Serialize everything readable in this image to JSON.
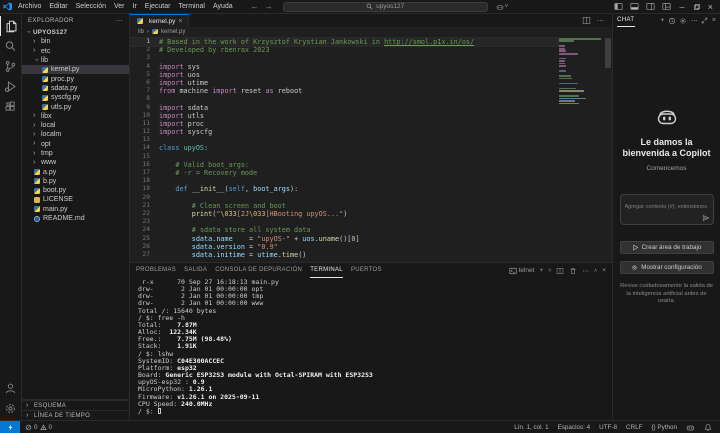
{
  "window": {
    "menus": [
      "Archivo",
      "Editar",
      "Selección",
      "Ver",
      "Ir",
      "Ejecutar",
      "Terminal",
      "Ayuda"
    ],
    "search_value": "upyos127"
  },
  "sidebar": {
    "header": "EXPLORADOR",
    "tree": [
      {
        "label": "UPYOS127",
        "depth": 0,
        "kind": "root",
        "state": "expanded"
      },
      {
        "label": "bin",
        "depth": 1,
        "kind": "folder",
        "state": "collapsed"
      },
      {
        "label": "etc",
        "depth": 1,
        "kind": "folder",
        "state": "collapsed"
      },
      {
        "label": "lib",
        "depth": 1,
        "kind": "folder",
        "state": "expanded"
      },
      {
        "label": "kernel.py",
        "depth": 2,
        "kind": "py",
        "selected": true
      },
      {
        "label": "proc.py",
        "depth": 2,
        "kind": "py"
      },
      {
        "label": "sdata.py",
        "depth": 2,
        "kind": "py"
      },
      {
        "label": "syscfg.py",
        "depth": 2,
        "kind": "py"
      },
      {
        "label": "utls.py",
        "depth": 2,
        "kind": "py"
      },
      {
        "label": "libx",
        "depth": 1,
        "kind": "folder",
        "state": "collapsed"
      },
      {
        "label": "local",
        "depth": 1,
        "kind": "folder",
        "state": "collapsed"
      },
      {
        "label": "localm",
        "depth": 1,
        "kind": "folder",
        "state": "collapsed"
      },
      {
        "label": "opt",
        "depth": 1,
        "kind": "folder",
        "state": "collapsed"
      },
      {
        "label": "tmp",
        "depth": 1,
        "kind": "folder",
        "state": "collapsed"
      },
      {
        "label": "www",
        "depth": 1,
        "kind": "folder",
        "state": "collapsed"
      },
      {
        "label": "a.py",
        "depth": 1,
        "kind": "py"
      },
      {
        "label": "b.py",
        "depth": 1,
        "kind": "py"
      },
      {
        "label": "boot.py",
        "depth": 1,
        "kind": "py"
      },
      {
        "label": "LICENSE",
        "depth": 1,
        "kind": "license"
      },
      {
        "label": "main.py",
        "depth": 1,
        "kind": "py"
      },
      {
        "label": "README.md",
        "depth": 1,
        "kind": "info"
      }
    ],
    "bottom_sections": [
      "ESQUEMA",
      "LÍNEA DE TIEMPO"
    ]
  },
  "editor": {
    "tab": {
      "label": "kernel.py"
    },
    "breadcrumb": [
      "lib",
      "kernel.py"
    ],
    "lines": [
      [
        [
          "# Based in the work of Krzysztof Krystian Jankowski in ",
          "cm"
        ],
        [
          "http://smol.p1x.in/os/",
          "cm link"
        ]
      ],
      [
        [
          "# Developed by rbenrax 2023",
          "cm"
        ]
      ],
      [],
      [
        [
          "import",
          "kw"
        ],
        [
          " sys",
          "pl"
        ]
      ],
      [
        [
          "import",
          "kw"
        ],
        [
          " uos",
          "pl"
        ]
      ],
      [
        [
          "import",
          "kw"
        ],
        [
          " utime",
          "pl"
        ]
      ],
      [
        [
          "from",
          "kw"
        ],
        [
          " machine ",
          "pl"
        ],
        [
          "import",
          "kw"
        ],
        [
          " reset ",
          "pl"
        ],
        [
          "as",
          "kw"
        ],
        [
          " reboot",
          "pl"
        ]
      ],
      [],
      [
        [
          "import",
          "kw"
        ],
        [
          " sdata",
          "pl"
        ]
      ],
      [
        [
          "import",
          "kw"
        ],
        [
          " utls",
          "pl"
        ]
      ],
      [
        [
          "import",
          "kw"
        ],
        [
          " proc",
          "pl"
        ]
      ],
      [
        [
          "import",
          "kw"
        ],
        [
          " syscfg",
          "pl"
        ]
      ],
      [],
      [
        [
          "class",
          "kb"
        ],
        [
          " ",
          "pl"
        ],
        [
          "upyOS",
          "cn"
        ],
        [
          ":",
          "pl"
        ]
      ],
      [],
      [
        [
          "    # Valid boot_args:",
          "cm"
        ]
      ],
      [
        [
          "    # -r = Recovery mode",
          "cm"
        ]
      ],
      [],
      [
        [
          "    ",
          "pl"
        ],
        [
          "def",
          "kb"
        ],
        [
          " ",
          "pl"
        ],
        [
          "__init__",
          "fn"
        ],
        [
          "(",
          "pl"
        ],
        [
          "self",
          "kb"
        ],
        [
          ", ",
          "pl"
        ],
        [
          "boot_args",
          "var"
        ],
        [
          "):",
          "pl"
        ]
      ],
      [],
      [
        [
          "        # Clean screen and boot",
          "cm"
        ]
      ],
      [
        [
          "        ",
          "pl"
        ],
        [
          "print",
          "fn"
        ],
        [
          "(",
          "pl"
        ],
        [
          "\"",
          "st"
        ],
        [
          "\\033",
          "esc"
        ],
        [
          "[2J",
          "st"
        ],
        [
          "\\033",
          "esc"
        ],
        [
          "[H",
          "st"
        ],
        [
          "Booting upyOS...",
          "st"
        ],
        [
          "\"",
          "st"
        ],
        [
          ")",
          "pl"
        ]
      ],
      [],
      [
        [
          "        # sdata store all system data",
          "cm"
        ]
      ],
      [
        [
          "        ",
          "pl"
        ],
        [
          "sdata",
          "var"
        ],
        [
          ".",
          "pl"
        ],
        [
          "name",
          "var"
        ],
        [
          "    = ",
          "pl"
        ],
        [
          "\"upyOS-\"",
          "st"
        ],
        [
          " + ",
          "pl"
        ],
        [
          "uos",
          "var"
        ],
        [
          ".",
          "pl"
        ],
        [
          "uname",
          "fn"
        ],
        [
          "()[",
          "pl"
        ],
        [
          "0",
          "num"
        ],
        [
          "]",
          "pl"
        ]
      ],
      [
        [
          "        ",
          "pl"
        ],
        [
          "sdata",
          "var"
        ],
        [
          ".",
          "pl"
        ],
        [
          "version",
          "var"
        ],
        [
          " = ",
          "pl"
        ],
        [
          "\"0.9\"",
          "st"
        ]
      ],
      [
        [
          "        ",
          "pl"
        ],
        [
          "sdata",
          "var"
        ],
        [
          ".",
          "pl"
        ],
        [
          "initime",
          "var"
        ],
        [
          " = ",
          "pl"
        ],
        [
          "utime",
          "var"
        ],
        [
          ".",
          "pl"
        ],
        [
          "time",
          "fn"
        ],
        [
          "()",
          "pl"
        ]
      ]
    ]
  },
  "panel": {
    "tabs": [
      "PROBLEMAS",
      "SALIDA",
      "CONSOLA DE DEPURACIÓN",
      "TERMINAL",
      "PUERTOS"
    ],
    "active_tab": "TERMINAL",
    "shell_label": "telnet",
    "terminal_lines": [
      [
        [
          " r-x      70 Sep 27 16:18:13 main.py"
        ]
      ],
      [
        [
          "drw-       2 Jan 01 00:00:00 opt"
        ]
      ],
      [
        [
          "drw-       2 Jan 01 00:00:00 tmp"
        ]
      ],
      [
        [
          "drw-       2 Jan 01 00:00:00 www"
        ]
      ],
      [
        [
          ""
        ]
      ],
      [
        [
          "Total /: 15640 bytes"
        ]
      ],
      [
        [
          "/ $: free -h"
        ]
      ],
      [
        [
          "Total:    "
        ],
        [
          "7.87M",
          "b"
        ]
      ],
      [
        [
          "Alloc:  "
        ],
        [
          "122.34K",
          "b"
        ]
      ],
      [
        [
          "Free.:    "
        ],
        [
          "7.75M (98.48%)",
          "b"
        ]
      ],
      [
        [
          "Stack:    "
        ],
        [
          "1.91K",
          "b"
        ]
      ],
      [
        [
          "/ $: lshw"
        ]
      ],
      [
        [
          "SystemID: "
        ],
        [
          "C04E300ACCEC",
          "b"
        ]
      ],
      [
        [
          "Platform: "
        ],
        [
          "esp32",
          "b"
        ]
      ],
      [
        [
          "Board: "
        ],
        [
          "Generic ESP32S3 module with Octal-SPIRAM with ESP32S3",
          "b"
        ]
      ],
      [
        [
          "upyOS-esp32 : "
        ],
        [
          "0.9",
          "b"
        ]
      ],
      [
        [
          "MicroPython: "
        ],
        [
          "1.26.1",
          "b"
        ]
      ],
      [
        [
          "Firmware: "
        ],
        [
          "v1.26.1 on 2025-09-11",
          "b"
        ]
      ],
      [
        [
          "CPU Speed: "
        ],
        [
          "240.0MHz",
          "b"
        ]
      ],
      [
        [
          "/ $: "
        ],
        [
          "",
          "cursor"
        ]
      ]
    ]
  },
  "chat": {
    "tab": "CHAT",
    "title": "Le damos la bienvenida a Copilot",
    "subtitle": "Comencemos",
    "input_placeholder": "Agregar contexto (#), extensiones (@)",
    "buttons": [
      "Crear área de trabajo",
      "Mostrar configuración"
    ],
    "disclaimer": "Revise cuidadosamente la salida de la inteligencia artificial antes de usarla."
  },
  "status_bar": {
    "errors": "0",
    "warnings": "0",
    "items": [
      "Lín. 1, col. 1",
      "Espacios: 4",
      "UTF-8",
      "CRLF",
      "{} Python"
    ]
  },
  "colors": {
    "accent": "#0078d4",
    "remote_badge": "#0078d4",
    "python_blue": "#3572A5",
    "python_yellow": "#ffd43b"
  }
}
